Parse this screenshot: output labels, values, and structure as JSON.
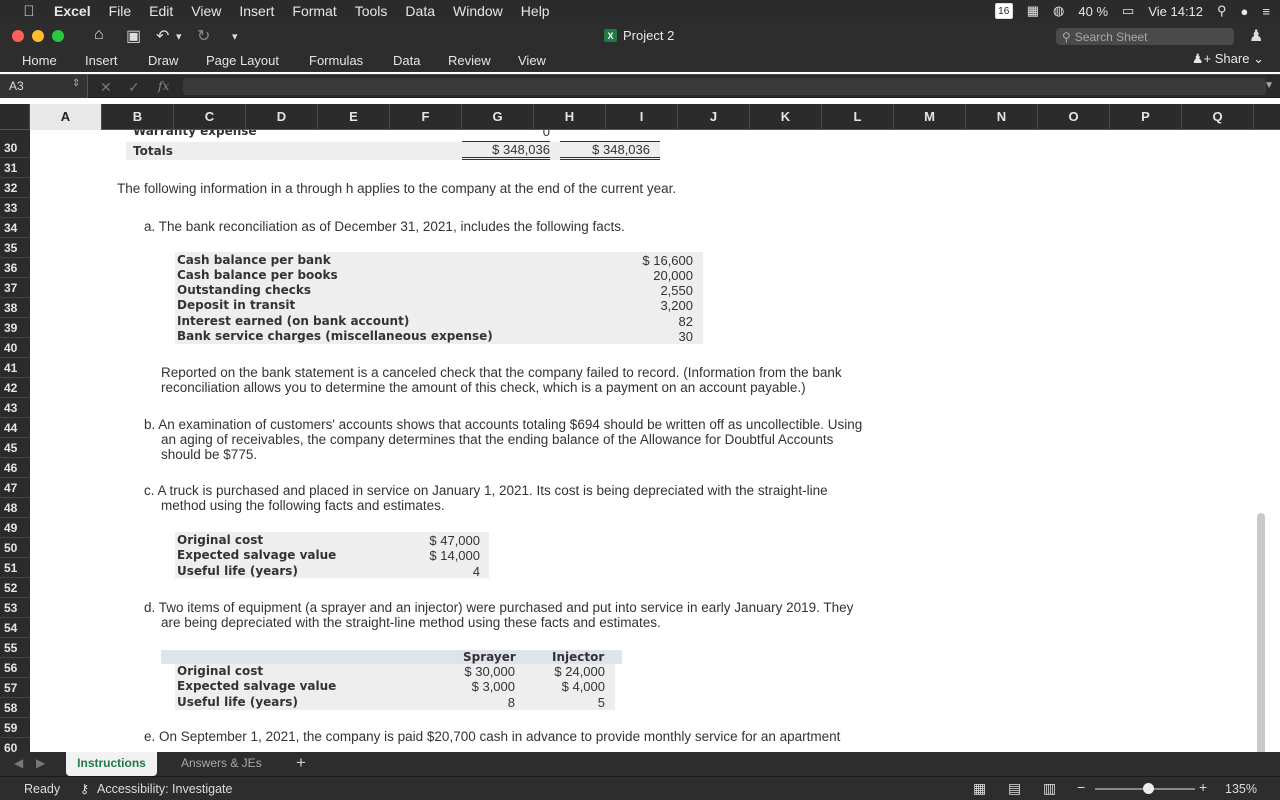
{
  "menubar": {
    "app": "Excel",
    "items": [
      "File",
      "Edit",
      "View",
      "Insert",
      "Format",
      "Tools",
      "Data",
      "Window",
      "Help"
    ],
    "calendar_day": "16",
    "battery": "40 %",
    "clock": "Vie 14:12"
  },
  "titlebar": {
    "doc_title": "Project 2",
    "search_placeholder": "Search Sheet"
  },
  "ribbon": {
    "tabs": [
      "Home",
      "Insert",
      "Draw",
      "Page Layout",
      "Formulas",
      "Data",
      "Review",
      "View"
    ],
    "share_label": "Share"
  },
  "formula_bar": {
    "cell_ref": "A3",
    "fx_label": "fx",
    "formula": ""
  },
  "columns": [
    "A",
    "B",
    "C",
    "D",
    "E",
    "F",
    "G",
    "H",
    "I",
    "J",
    "K",
    "L",
    "M",
    "N",
    "O",
    "P",
    "Q"
  ],
  "selected_column": "A",
  "rows": [
    "30",
    "31",
    "32",
    "33",
    "34",
    "35",
    "36",
    "37",
    "38",
    "39",
    "40",
    "41",
    "42",
    "43",
    "44",
    "45",
    "46",
    "47",
    "48",
    "49",
    "50",
    "51",
    "52",
    "53",
    "54",
    "55",
    "56",
    "57",
    "58",
    "59",
    "60"
  ],
  "sheet": {
    "partial_row_label": "Warranty expense",
    "partial_row_value": "0",
    "totals_label": "Totals",
    "totals_debit": "$ 348,036",
    "totals_credit": "$ 348,036",
    "intro": "The following information in a through h applies to the company at the end of the current year.",
    "a_text": "a. The bank reconciliation as of December 31, 2021, includes the following facts.",
    "a_table": [
      {
        "label": "Cash balance per bank",
        "value": "$ 16,600"
      },
      {
        "label": "Cash balance per books",
        "value": "20,000"
      },
      {
        "label": "Outstanding checks",
        "value": "2,550"
      },
      {
        "label": "Deposit in transit",
        "value": "3,200"
      },
      {
        "label": "Interest earned (on bank account)",
        "value": "82"
      },
      {
        "label": "Bank service charges (miscellaneous expense)",
        "value": "30"
      }
    ],
    "a_note_1": "Reported on the bank statement is a canceled check that the company failed to record. (Information from the bank",
    "a_note_2": "reconciliation allows you to determine the amount of this check, which is a payment on an account payable.)",
    "b_text_1": "b. An examination of customers' accounts shows that accounts totaling $694 should be written off as uncollectible. Using",
    "b_text_2": "an aging of receivables, the company determines that the ending balance of the Allowance for Doubtful Accounts",
    "b_text_3": "should be $775.",
    "c_text_1": "c. A truck is purchased and placed in service on January 1, 2021. Its cost is being depreciated with the straight-line",
    "c_text_2": "method using the following facts and estimates.",
    "c_table": [
      {
        "label": "Original cost",
        "value": "$ 47,000"
      },
      {
        "label": "Expected salvage value",
        "value": "$ 14,000"
      },
      {
        "label": "Useful life (years)",
        "value": "4"
      }
    ],
    "d_text_1": "d. Two items of equipment (a sprayer and an injector) were purchased and put into service in early January 2019. They",
    "d_text_2": "are being depreciated with the straight-line method using these facts and estimates.",
    "d_headers": [
      "Sprayer",
      "Injector"
    ],
    "d_table": [
      {
        "label": "Original cost",
        "sprayer": "$ 30,000",
        "injector": "$ 24,000"
      },
      {
        "label": "Expected salvage value",
        "sprayer": "$ 3,000",
        "injector": "$ 4,000"
      },
      {
        "label": "Useful life (years)",
        "sprayer": "8",
        "injector": "5"
      }
    ],
    "e_text_1": "e. On September 1, 2021, the company is paid $20,700 cash in advance to provide monthly service for an apartment"
  },
  "sheet_tabs": [
    "Instructions",
    "Answers & JEs"
  ],
  "status": {
    "ready": "Ready",
    "accessibility": "Accessibility: Investigate",
    "zoom": "135%"
  },
  "colors": {
    "excel_green": "#1f7a45",
    "chrome_dark": "#2d2d2d"
  }
}
